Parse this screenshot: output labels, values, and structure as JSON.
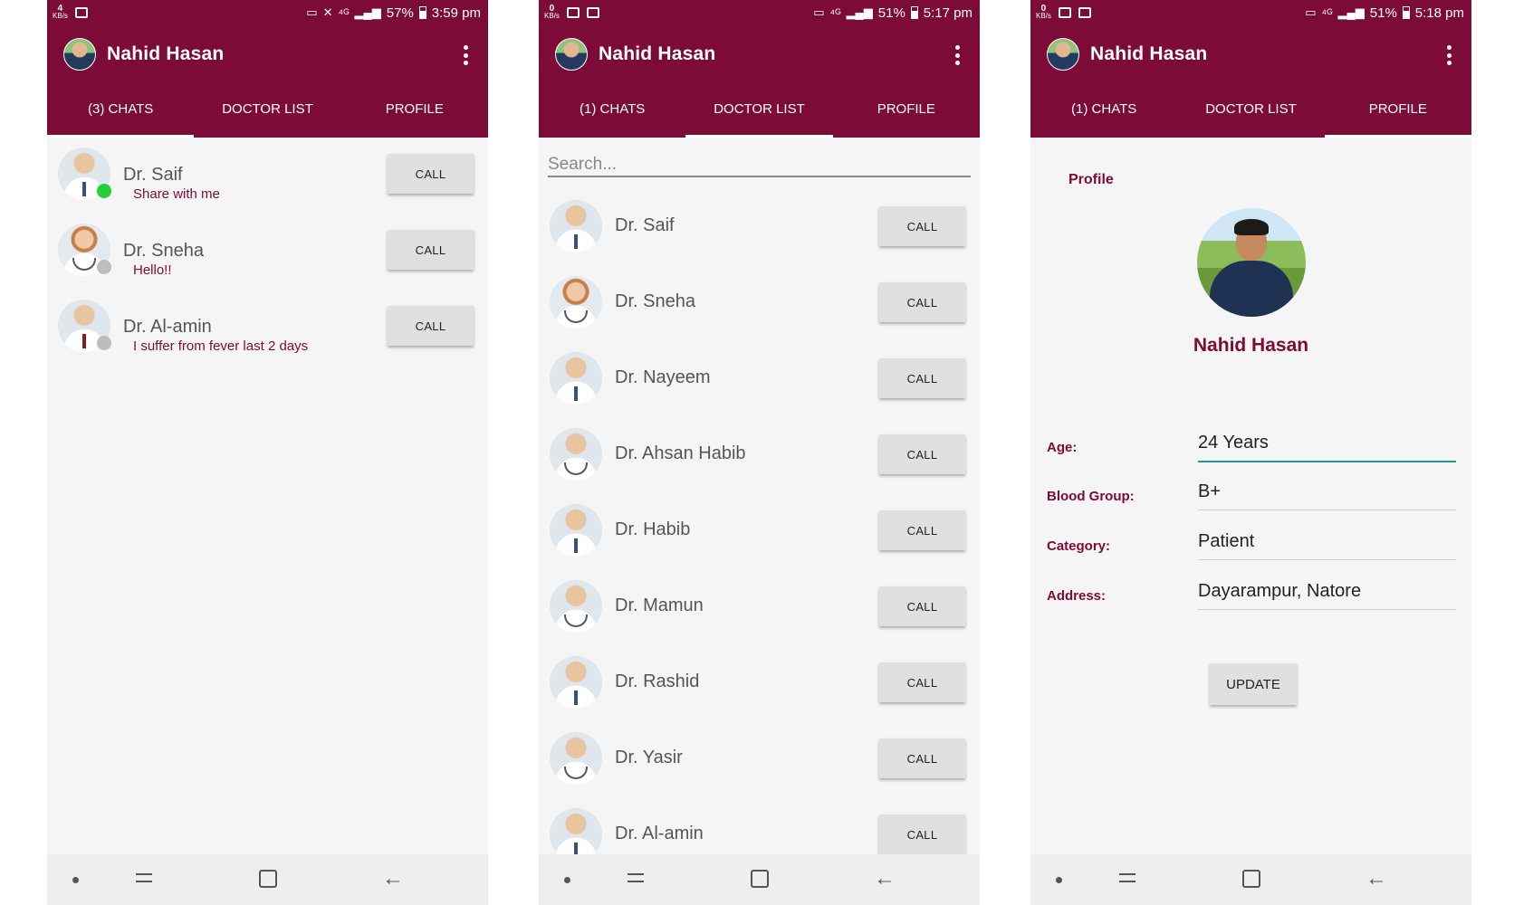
{
  "screens": [
    {
      "status": {
        "kbs_value": "4",
        "kbs_unit": "KB/s",
        "battery": "57%",
        "time": "3:59 pm"
      },
      "user_name": "Nahid Hasan",
      "tabs": [
        "(3) CHATS",
        "DOCTOR LIST",
        "PROFILE"
      ],
      "active_tab": 0,
      "chats": [
        {
          "name": "Dr. Saif",
          "message": "Share with me",
          "online": true,
          "call_label": "CALL"
        },
        {
          "name": "Dr. Sneha",
          "message": "Hello!!",
          "online": false,
          "call_label": "CALL"
        },
        {
          "name": "Dr. Al-amin",
          "message": "I suffer from fever last 2 days",
          "online": false,
          "call_label": "CALL"
        }
      ]
    },
    {
      "status": {
        "kbs_value": "0",
        "kbs_unit": "KB/s",
        "battery": "51%",
        "time": "5:17 pm"
      },
      "user_name": "Nahid Hasan",
      "tabs": [
        "(1) CHATS",
        "DOCTOR LIST",
        "PROFILE"
      ],
      "active_tab": 1,
      "search_placeholder": "Search...",
      "doctors": [
        {
          "name": "Dr. Saif",
          "call_label": "CALL"
        },
        {
          "name": "Dr. Sneha",
          "call_label": "CALL"
        },
        {
          "name": "Dr. Nayeem",
          "call_label": "CALL"
        },
        {
          "name": "Dr. Ahsan Habib",
          "call_label": "CALL"
        },
        {
          "name": "Dr. Habib",
          "call_label": "CALL"
        },
        {
          "name": "Dr. Mamun",
          "call_label": "CALL"
        },
        {
          "name": "Dr. Rashid",
          "call_label": "CALL"
        },
        {
          "name": "Dr. Yasir",
          "call_label": "CALL"
        },
        {
          "name": "Dr. Al-amin",
          "call_label": "CALL"
        }
      ]
    },
    {
      "status": {
        "kbs_value": "0",
        "kbs_unit": "KB/s",
        "battery": "51%",
        "time": "5:18 pm"
      },
      "user_name": "Nahid Hasan",
      "tabs": [
        "(1) CHATS",
        "DOCTOR LIST",
        "PROFILE"
      ],
      "active_tab": 2,
      "profile": {
        "section_label": "Profile",
        "name": "Nahid Hasan",
        "fields": [
          {
            "label": "Age:",
            "value": "24 Years"
          },
          {
            "label": "Blood Group:",
            "value": "B+"
          },
          {
            "label": "Category:",
            "value": "Patient"
          },
          {
            "label": "Address:",
            "value": "Dayarampur, Natore"
          }
        ],
        "update_label": "UPDATE"
      }
    }
  ],
  "colors": {
    "primary": "#7d0b37",
    "accent_underline": "#1b9e8f",
    "online": "#22d038",
    "offline": "#bdbdbd"
  },
  "icons": [
    "cast-icon",
    "mute-icon",
    "4g-icon",
    "signal-icon",
    "battery-icon",
    "overflow-menu-icon",
    "nav-dot-icon",
    "nav-recent-icon",
    "nav-home-icon",
    "nav-back-icon"
  ]
}
